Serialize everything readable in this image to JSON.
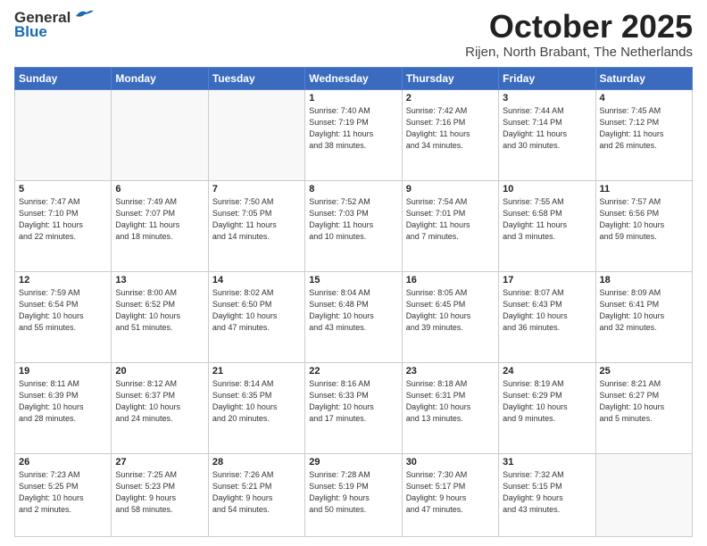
{
  "header": {
    "logo_general": "General",
    "logo_blue": "Blue",
    "month_title": "October 2025",
    "location": "Rijen, North Brabant, The Netherlands"
  },
  "weekdays": [
    "Sunday",
    "Monday",
    "Tuesday",
    "Wednesday",
    "Thursday",
    "Friday",
    "Saturday"
  ],
  "weeks": [
    [
      {
        "day": "",
        "info": ""
      },
      {
        "day": "",
        "info": ""
      },
      {
        "day": "",
        "info": ""
      },
      {
        "day": "1",
        "info": "Sunrise: 7:40 AM\nSunset: 7:19 PM\nDaylight: 11 hours\nand 38 minutes."
      },
      {
        "day": "2",
        "info": "Sunrise: 7:42 AM\nSunset: 7:16 PM\nDaylight: 11 hours\nand 34 minutes."
      },
      {
        "day": "3",
        "info": "Sunrise: 7:44 AM\nSunset: 7:14 PM\nDaylight: 11 hours\nand 30 minutes."
      },
      {
        "day": "4",
        "info": "Sunrise: 7:45 AM\nSunset: 7:12 PM\nDaylight: 11 hours\nand 26 minutes."
      }
    ],
    [
      {
        "day": "5",
        "info": "Sunrise: 7:47 AM\nSunset: 7:10 PM\nDaylight: 11 hours\nand 22 minutes."
      },
      {
        "day": "6",
        "info": "Sunrise: 7:49 AM\nSunset: 7:07 PM\nDaylight: 11 hours\nand 18 minutes."
      },
      {
        "day": "7",
        "info": "Sunrise: 7:50 AM\nSunset: 7:05 PM\nDaylight: 11 hours\nand 14 minutes."
      },
      {
        "day": "8",
        "info": "Sunrise: 7:52 AM\nSunset: 7:03 PM\nDaylight: 11 hours\nand 10 minutes."
      },
      {
        "day": "9",
        "info": "Sunrise: 7:54 AM\nSunset: 7:01 PM\nDaylight: 11 hours\nand 7 minutes."
      },
      {
        "day": "10",
        "info": "Sunrise: 7:55 AM\nSunset: 6:58 PM\nDaylight: 11 hours\nand 3 minutes."
      },
      {
        "day": "11",
        "info": "Sunrise: 7:57 AM\nSunset: 6:56 PM\nDaylight: 10 hours\nand 59 minutes."
      }
    ],
    [
      {
        "day": "12",
        "info": "Sunrise: 7:59 AM\nSunset: 6:54 PM\nDaylight: 10 hours\nand 55 minutes."
      },
      {
        "day": "13",
        "info": "Sunrise: 8:00 AM\nSunset: 6:52 PM\nDaylight: 10 hours\nand 51 minutes."
      },
      {
        "day": "14",
        "info": "Sunrise: 8:02 AM\nSunset: 6:50 PM\nDaylight: 10 hours\nand 47 minutes."
      },
      {
        "day": "15",
        "info": "Sunrise: 8:04 AM\nSunset: 6:48 PM\nDaylight: 10 hours\nand 43 minutes."
      },
      {
        "day": "16",
        "info": "Sunrise: 8:05 AM\nSunset: 6:45 PM\nDaylight: 10 hours\nand 39 minutes."
      },
      {
        "day": "17",
        "info": "Sunrise: 8:07 AM\nSunset: 6:43 PM\nDaylight: 10 hours\nand 36 minutes."
      },
      {
        "day": "18",
        "info": "Sunrise: 8:09 AM\nSunset: 6:41 PM\nDaylight: 10 hours\nand 32 minutes."
      }
    ],
    [
      {
        "day": "19",
        "info": "Sunrise: 8:11 AM\nSunset: 6:39 PM\nDaylight: 10 hours\nand 28 minutes."
      },
      {
        "day": "20",
        "info": "Sunrise: 8:12 AM\nSunset: 6:37 PM\nDaylight: 10 hours\nand 24 minutes."
      },
      {
        "day": "21",
        "info": "Sunrise: 8:14 AM\nSunset: 6:35 PM\nDaylight: 10 hours\nand 20 minutes."
      },
      {
        "day": "22",
        "info": "Sunrise: 8:16 AM\nSunset: 6:33 PM\nDaylight: 10 hours\nand 17 minutes."
      },
      {
        "day": "23",
        "info": "Sunrise: 8:18 AM\nSunset: 6:31 PM\nDaylight: 10 hours\nand 13 minutes."
      },
      {
        "day": "24",
        "info": "Sunrise: 8:19 AM\nSunset: 6:29 PM\nDaylight: 10 hours\nand 9 minutes."
      },
      {
        "day": "25",
        "info": "Sunrise: 8:21 AM\nSunset: 6:27 PM\nDaylight: 10 hours\nand 5 minutes."
      }
    ],
    [
      {
        "day": "26",
        "info": "Sunrise: 7:23 AM\nSunset: 5:25 PM\nDaylight: 10 hours\nand 2 minutes."
      },
      {
        "day": "27",
        "info": "Sunrise: 7:25 AM\nSunset: 5:23 PM\nDaylight: 9 hours\nand 58 minutes."
      },
      {
        "day": "28",
        "info": "Sunrise: 7:26 AM\nSunset: 5:21 PM\nDaylight: 9 hours\nand 54 minutes."
      },
      {
        "day": "29",
        "info": "Sunrise: 7:28 AM\nSunset: 5:19 PM\nDaylight: 9 hours\nand 50 minutes."
      },
      {
        "day": "30",
        "info": "Sunrise: 7:30 AM\nSunset: 5:17 PM\nDaylight: 9 hours\nand 47 minutes."
      },
      {
        "day": "31",
        "info": "Sunrise: 7:32 AM\nSunset: 5:15 PM\nDaylight: 9 hours\nand 43 minutes."
      },
      {
        "day": "",
        "info": ""
      }
    ]
  ]
}
